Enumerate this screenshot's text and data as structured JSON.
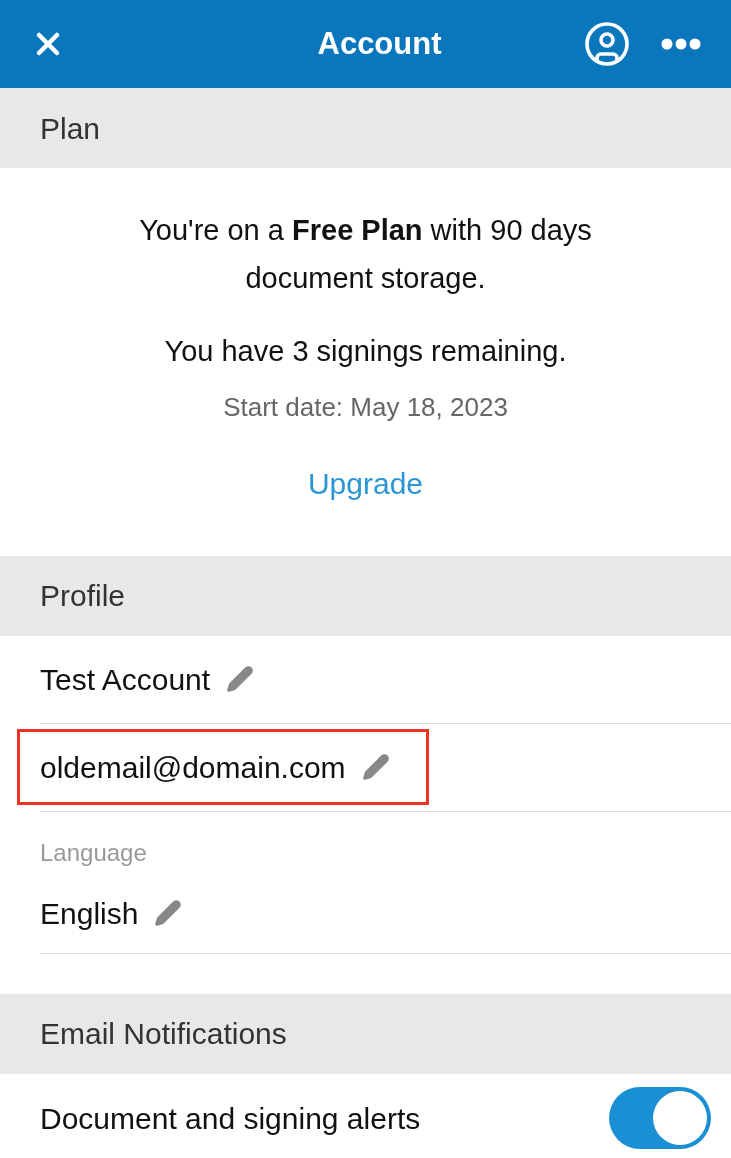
{
  "header": {
    "title": "Account"
  },
  "plan": {
    "heading": "Plan",
    "summary": "You're on a **Free Plan** with 90 days document storage.",
    "signings": "You have 3 signings remaining.",
    "start_date": "Start date: May 18, 2023",
    "upgrade": "Upgrade"
  },
  "profile": {
    "heading": "Profile",
    "fields": [
      {
        "value": "Test Account",
        "highlighted": false
      },
      {
        "value": "oldemail@domain.com",
        "highlighted": true
      }
    ],
    "language": {
      "label": "Language",
      "value": "English"
    }
  },
  "notifications": {
    "heading": "Email Notifications",
    "items": [
      {
        "label": "Document and signing alerts",
        "on": true
      }
    ]
  }
}
